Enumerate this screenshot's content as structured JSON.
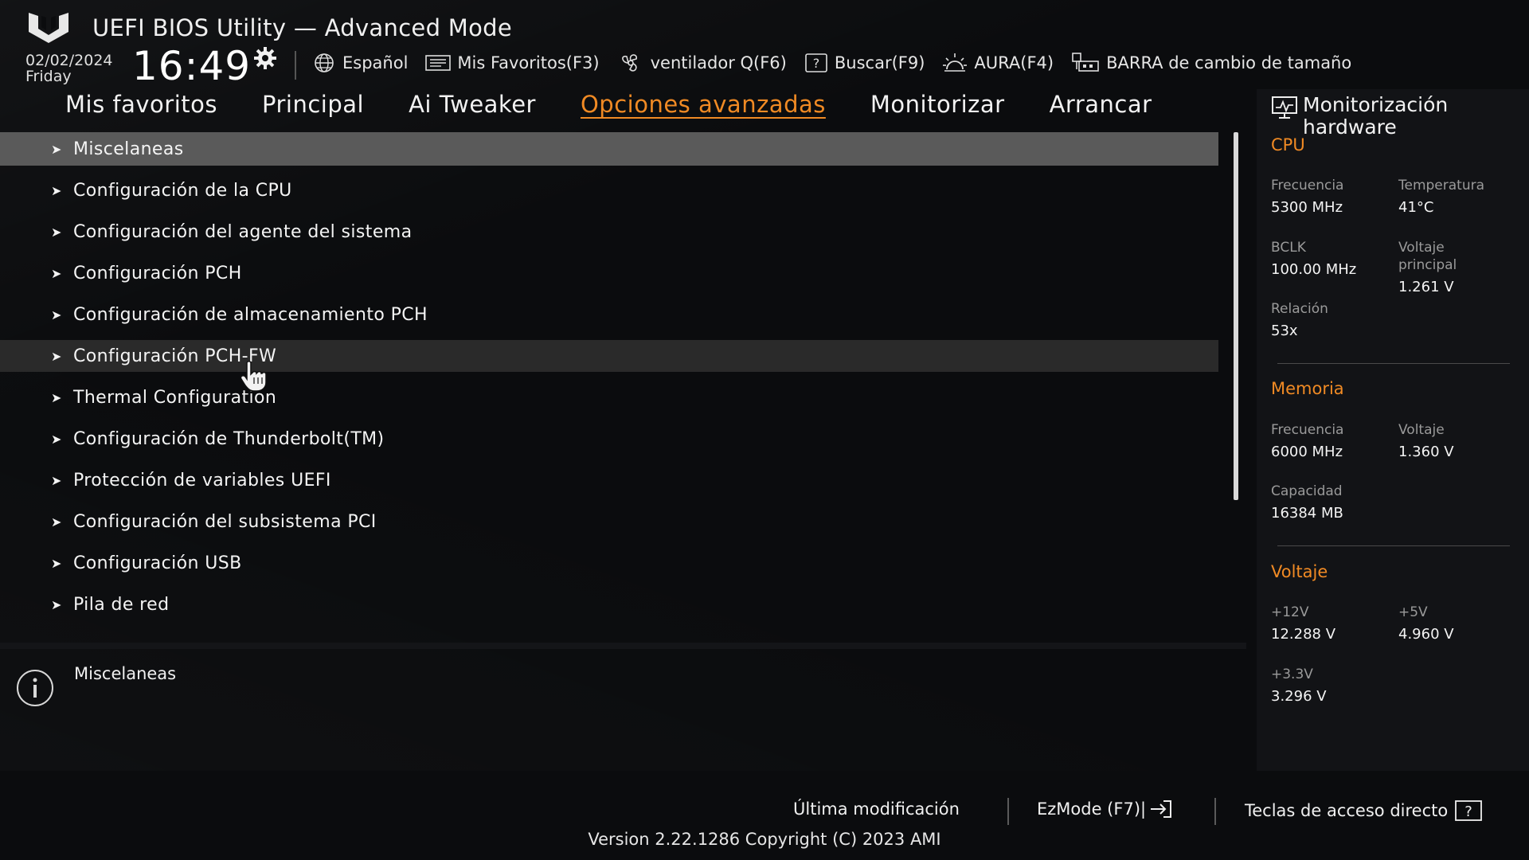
{
  "header": {
    "title": "UEFI BIOS Utility — Advanced Mode",
    "date": "02/02/2024",
    "day": "Friday",
    "time": "16:49",
    "toolbar": [
      {
        "label": "Español",
        "icon": "globe-icon"
      },
      {
        "label": "Mis Favoritos(F3)",
        "icon": "favorites-icon"
      },
      {
        "label": "ventilador Q(F6)",
        "icon": "fan-icon"
      },
      {
        "label": "Buscar(F9)",
        "icon": "help-box-icon"
      },
      {
        "label": "AURA(F4)",
        "icon": "aura-icon"
      },
      {
        "label": "BARRA de cambio de tamaño",
        "icon": "resize-bar-icon"
      }
    ]
  },
  "tabs": [
    {
      "label": "Mis favoritos"
    },
    {
      "label": "Principal"
    },
    {
      "label": "Ai Tweaker"
    },
    {
      "label": "Opciones avanzadas",
      "active": true
    },
    {
      "label": "Monitorizar"
    },
    {
      "label": "Arrancar"
    }
  ],
  "menu": {
    "items": [
      {
        "label": "Miscelaneas",
        "state": "selected"
      },
      {
        "label": "Configuración de la CPU"
      },
      {
        "label": "Configuración del agente del sistema"
      },
      {
        "label": "Configuración PCH"
      },
      {
        "label": "Configuración de almacenamiento PCH"
      },
      {
        "label": "Configuración PCH-FW",
        "state": "hover"
      },
      {
        "label": "Thermal Configuration"
      },
      {
        "label": "Configuración de Thunderbolt(TM)"
      },
      {
        "label": "Protección de variables UEFI"
      },
      {
        "label": "Configuración del subsistema PCI"
      },
      {
        "label": "Configuración USB"
      },
      {
        "label": "Pila de red"
      }
    ]
  },
  "help": {
    "text": "Miscelaneas"
  },
  "hardware_monitor": {
    "title": "Monitorización hardware",
    "cpu": {
      "heading": "CPU",
      "freq_label": "Frecuencia",
      "freq_value": "5300 MHz",
      "temp_label": "Temperatura",
      "temp_value": "41°C",
      "bclk_label": "BCLK",
      "bclk_value": "100.00 MHz",
      "vcore_label_1": "Voltaje",
      "vcore_label_2": "principal",
      "vcore_value": "1.261 V",
      "ratio_label": "Relación",
      "ratio_value": "53x"
    },
    "memory": {
      "heading": "Memoria",
      "freq_label": "Frecuencia",
      "freq_value": "6000 MHz",
      "volt_label": "Voltaje",
      "volt_value": "1.360 V",
      "cap_label": "Capacidad",
      "cap_value": "16384 MB"
    },
    "voltage": {
      "heading": "Voltaje",
      "v12_label": "+12V",
      "v12_value": "12.288 V",
      "v5_label": "+5V",
      "v5_value": "4.960 V",
      "v33_label": "+3.3V",
      "v33_value": "3.296 V"
    }
  },
  "footer": {
    "last_modified": "Última modificación",
    "ezmode": "EzMode (F7)|",
    "hotkeys": "Teclas de acceso directo",
    "version": "Version 2.22.1286 Copyright (C) 2023 AMI"
  },
  "colors": {
    "accent": "#f08a24",
    "selected_row": "#5a5a5a",
    "background": "#0b0c0e"
  }
}
